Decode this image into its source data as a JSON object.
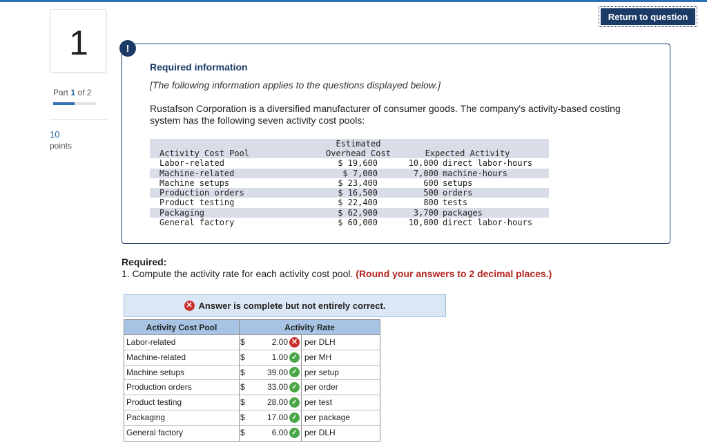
{
  "header": {
    "return_label": "Return to question"
  },
  "rail": {
    "question_number": "1",
    "part_label": "Part",
    "part_current": "1",
    "part_of": "of 2",
    "points_value": "10",
    "points_label": "points"
  },
  "info": {
    "alert_glyph": "!",
    "title": "Required information",
    "subtitle": "[The following information applies to the questions displayed below.]",
    "intro": "Rustafson Corporation is a diversified manufacturer of consumer goods. The company's activity-based costing system has the following seven activity cost pools:",
    "table": {
      "header_top": "Estimated",
      "col1": "Activity Cost Pool",
      "col2": "Overhead Cost",
      "col3": "Expected Activity",
      "rows": [
        {
          "pool": "Labor-related",
          "cost": "$ 19,600",
          "qty": "10,000",
          "unit": "direct labor-hours"
        },
        {
          "pool": "Machine-related",
          "cost": "$ 7,000",
          "qty": "7,000",
          "unit": "machine-hours"
        },
        {
          "pool": "Machine setups",
          "cost": "$ 23,400",
          "qty": "600",
          "unit": "setups"
        },
        {
          "pool": "Production orders",
          "cost": "$ 16,500",
          "qty": "500",
          "unit": "orders"
        },
        {
          "pool": "Product testing",
          "cost": "$ 22,400",
          "qty": "800",
          "unit": "tests"
        },
        {
          "pool": "Packaging",
          "cost": "$ 62,900",
          "qty": "3,700",
          "unit": "packages"
        },
        {
          "pool": "General factory",
          "cost": "$ 60,000",
          "qty": "10,000",
          "unit": "direct labor-hours"
        }
      ]
    }
  },
  "required": {
    "title": "Required:",
    "text": "1. Compute the activity rate for each activity cost pool.",
    "note": "(Round your answers to 2 decimal places.)"
  },
  "answer": {
    "banner": "Answer is complete but not entirely correct.",
    "col1": "Activity Cost Pool",
    "col2": "Activity Rate",
    "rows": [
      {
        "pool": "Labor-related",
        "currency": "$",
        "value": "2.00",
        "status": "incorrect",
        "unit": "per DLH"
      },
      {
        "pool": "Machine-related",
        "currency": "$",
        "value": "1.00",
        "status": "correct",
        "unit": "per MH"
      },
      {
        "pool": "Machine setups",
        "currency": "$",
        "value": "39.00",
        "status": "correct",
        "unit": "per setup"
      },
      {
        "pool": "Production orders",
        "currency": "$",
        "value": "33.00",
        "status": "correct",
        "unit": "per order"
      },
      {
        "pool": "Product testing",
        "currency": "$",
        "value": "28.00",
        "status": "correct",
        "unit": "per test"
      },
      {
        "pool": "Packaging",
        "currency": "$",
        "value": "17.00",
        "status": "correct",
        "unit": "per package"
      },
      {
        "pool": "General factory",
        "currency": "$",
        "value": "6.00",
        "status": "correct",
        "unit": "per DLH"
      }
    ]
  }
}
